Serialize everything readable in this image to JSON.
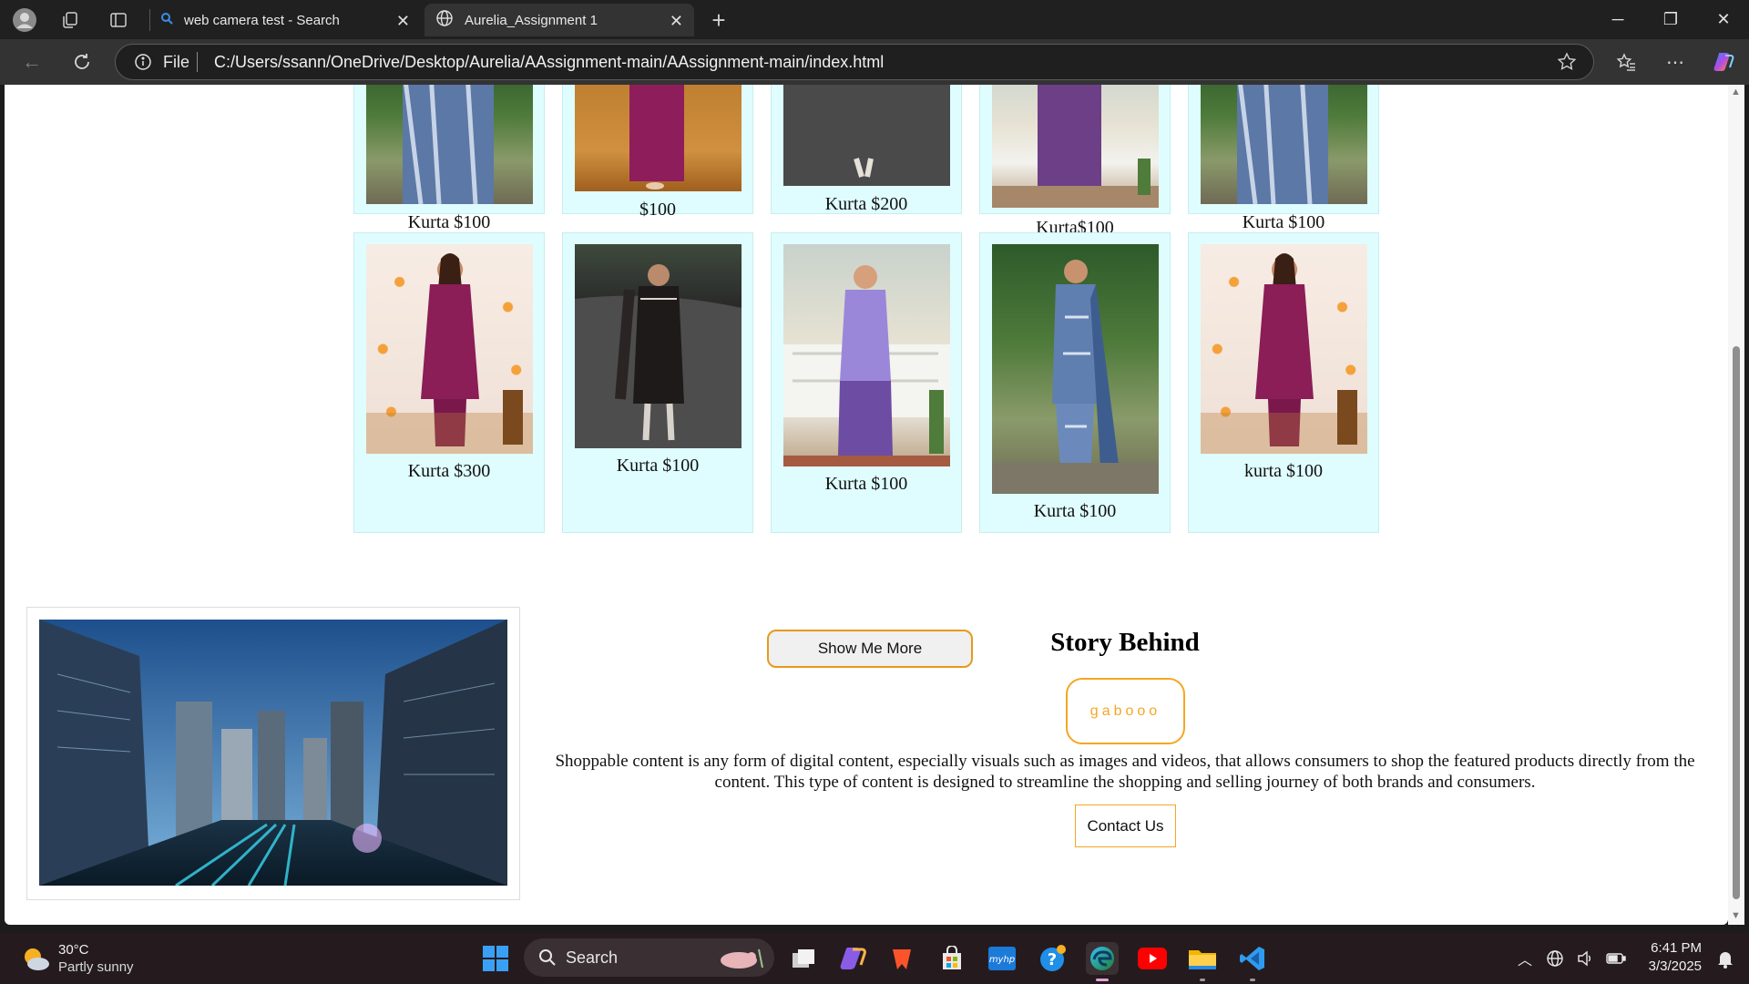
{
  "browser": {
    "tabs": [
      {
        "label": "web camera test - Search",
        "icon": "search-icon",
        "active": false
      },
      {
        "label": "Aurelia_Assignment 1",
        "icon": "globe-icon",
        "active": true
      }
    ],
    "address": {
      "scheme_label": "File",
      "url": "C:/Users/ssann/OneDrive/Desktop/Aurelia/AAssignment-main/AAssignment-main/index.html"
    }
  },
  "page": {
    "top_row_cards": [
      {
        "label": "Kurta $100",
        "image": "kurta-blue-dupatta"
      },
      {
        "label": "$100",
        "image": "kurta-magenta"
      },
      {
        "label": "Kurta $200",
        "image": "kurta-black-road"
      },
      {
        "label": "Kurta$100",
        "image": "kurta-purple"
      },
      {
        "label": "Kurta $100",
        "image": "kurta-blue-dupatta"
      }
    ],
    "bottom_row_cards": [
      {
        "label": "Kurta $300",
        "image": "kurta-magenta"
      },
      {
        "label": "Kurta $100",
        "image": "kurta-black-road"
      },
      {
        "label": "Kurta $100",
        "image": "kurta-purple"
      },
      {
        "label": "Kurta $100",
        "image": "kurta-blue-dupatta"
      },
      {
        "label": "kurta $100",
        "image": "kurta-magenta"
      }
    ],
    "show_more_label": "Show Me More",
    "story": {
      "title": "Story Behind",
      "badge": "gabooo",
      "text": "Shoppable content is any form of digital content, especially visuals such as images and videos, that allows consumers to shop the featured products directly from the content. This type of content is designed to streamline the shopping and selling journey of both brands and consumers.",
      "contact_label": "Contact Us",
      "image": "city-night-skyline"
    },
    "colors": {
      "card_bg": "#dffdff",
      "accent_orange": "#f5a623"
    }
  },
  "taskbar": {
    "weather": {
      "temp": "30°C",
      "condition": "Partly sunny"
    },
    "search_label": "Search",
    "clock": {
      "time": "6:41 PM",
      "date": "3/3/2025"
    }
  }
}
